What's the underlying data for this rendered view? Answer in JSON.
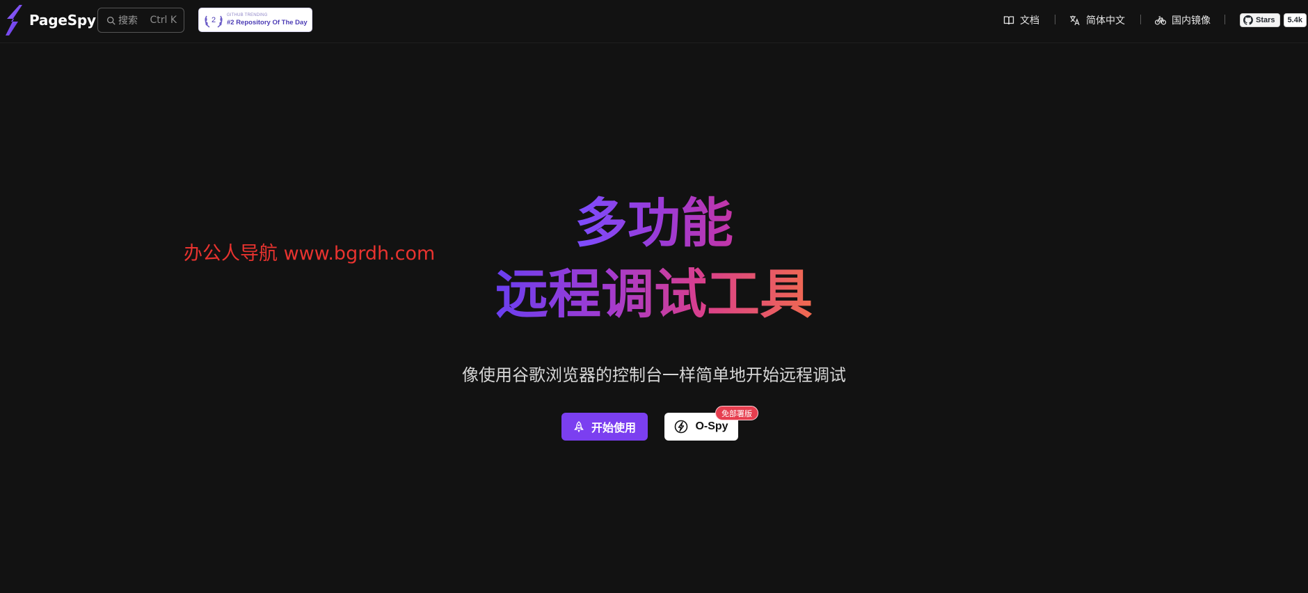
{
  "header": {
    "brand": "PageSpy",
    "search": {
      "placeholder": "搜索",
      "shortcut": "Ctrl K"
    },
    "trending": {
      "rank": "2",
      "caption": "GITHUB TRENDING",
      "label": "#2 Repository Of The Day"
    },
    "nav": {
      "docs": "文档",
      "language": "简体中文",
      "mirror": "国内镜像"
    },
    "github": {
      "stars_label": "Stars",
      "stars_count": "5.4k"
    }
  },
  "hero": {
    "line1": "多功能",
    "line2": "远程调试工具",
    "subtitle": "像使用谷歌浏览器的控制台一样简单地开始远程调试",
    "watermark": "办公人导航 www.bgrdh.com",
    "primary_button": "开始使用",
    "secondary_button": "O-Spy",
    "secondary_badge": "免部署版"
  },
  "colors": {
    "background": "#121212",
    "accent": "#7b3ff0",
    "badge": "#e63e4f",
    "watermark": "#e8332f"
  },
  "icons": [
    "pagespy-logo-icon",
    "search-icon",
    "laurel-icon",
    "book-icon",
    "translate-icon",
    "bicycle-icon",
    "github-icon",
    "rocket-icon",
    "ospy-icon"
  ]
}
